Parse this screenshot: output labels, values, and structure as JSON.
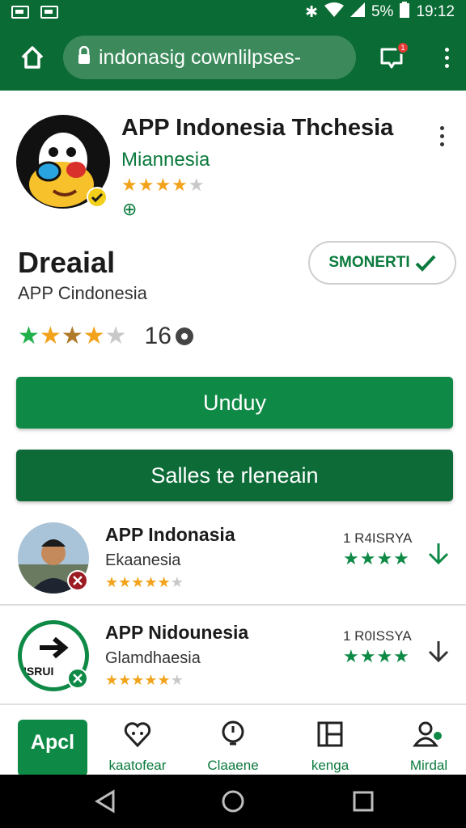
{
  "status_bar": {
    "battery": "5%",
    "time": "19:12"
  },
  "browser": {
    "url": "indonasig cownlilpses-",
    "tab_badge": "1"
  },
  "app": {
    "title": "APP Indonesia Thchesia",
    "developer": "Miannesia",
    "stars": "★★★★",
    "star_empty": "★",
    "symbol": "⊕"
  },
  "detail": {
    "name": "Dreaial",
    "subtitle": "APP Cindonesia",
    "follow_label": "SMONERTI",
    "rating_count": "16"
  },
  "buttons": {
    "primary": "Unduy",
    "secondary": "Salles te rleneain"
  },
  "list": [
    {
      "title": "APP Indonasia",
      "subtitle": "Ekaanesia",
      "size": "1 R4ISRYA",
      "stars_full": "★★★★★",
      "stars_empty": "★",
      "green_stars": "★★★★"
    },
    {
      "title": "APP Nidounesia",
      "subtitle": "Glamdhaesia",
      "size": "1 R0ISSYA",
      "stars_full": "★★★★★",
      "stars_empty": "★",
      "green_stars": "★★★★",
      "thumb_text": "ISRUI"
    }
  ],
  "bottom_nav": [
    {
      "label": "Apcl"
    },
    {
      "label": "kaatofear"
    },
    {
      "label": "Claaene"
    },
    {
      "label": "kenga"
    },
    {
      "label": "Mirdal"
    }
  ],
  "colors": {
    "brand": "#0a6b35",
    "button": "#0f8a46",
    "accent_star": "#f2a31b",
    "green_star": "#22b04b"
  }
}
